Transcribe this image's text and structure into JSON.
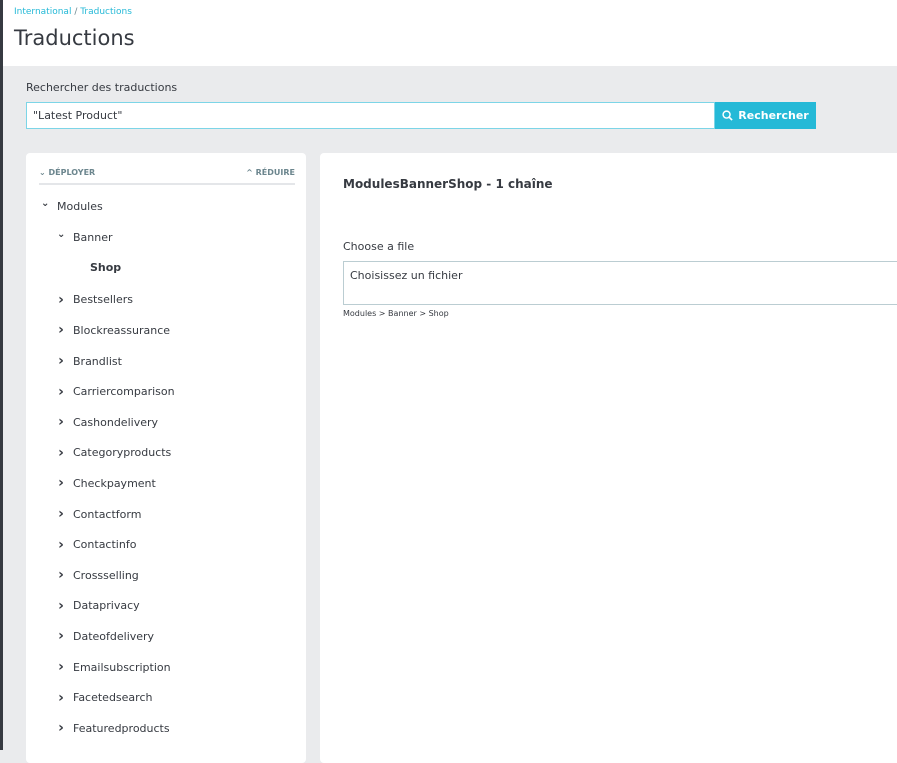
{
  "breadcrumb": {
    "parent": "International",
    "separator": " / ",
    "current": "Traductions"
  },
  "page_title": "Traductions",
  "search": {
    "label": "Rechercher des traductions",
    "value": "\"Latest Product\"",
    "button": "Rechercher"
  },
  "tree": {
    "expand": "DÉPLOYER",
    "collapse": "RÉDUIRE",
    "items": [
      {
        "label": "Modules",
        "level": 0,
        "state": "open"
      },
      {
        "label": "Banner",
        "level": 1,
        "state": "open"
      },
      {
        "label": "Shop",
        "level": 2,
        "state": "selected"
      },
      {
        "label": "Bestsellers",
        "level": 1,
        "state": "closed"
      },
      {
        "label": "Blockreassurance",
        "level": 1,
        "state": "closed"
      },
      {
        "label": "Brandlist",
        "level": 1,
        "state": "closed"
      },
      {
        "label": "Carriercomparison",
        "level": 1,
        "state": "closed"
      },
      {
        "label": "Cashondelivery",
        "level": 1,
        "state": "closed"
      },
      {
        "label": "Categoryproducts",
        "level": 1,
        "state": "closed"
      },
      {
        "label": "Checkpayment",
        "level": 1,
        "state": "closed"
      },
      {
        "label": "Contactform",
        "level": 1,
        "state": "closed"
      },
      {
        "label": "Contactinfo",
        "level": 1,
        "state": "closed"
      },
      {
        "label": "Crossselling",
        "level": 1,
        "state": "closed"
      },
      {
        "label": "Dataprivacy",
        "level": 1,
        "state": "closed"
      },
      {
        "label": "Dateofdelivery",
        "level": 1,
        "state": "closed"
      },
      {
        "label": "Emailsubscription",
        "level": 1,
        "state": "closed"
      },
      {
        "label": "Facetedsearch",
        "level": 1,
        "state": "closed"
      },
      {
        "label": "Featuredproducts",
        "level": 1,
        "state": "closed"
      }
    ]
  },
  "main": {
    "title": "ModulesBannerShop - 1 chaîne",
    "file_label": "Choose a file",
    "file_value": "Choisissez un fichier",
    "path": "Modules > Banner > Shop"
  },
  "colors": {
    "accent": "#25b9d7",
    "text": "#363a41",
    "background": "#eaebed"
  }
}
